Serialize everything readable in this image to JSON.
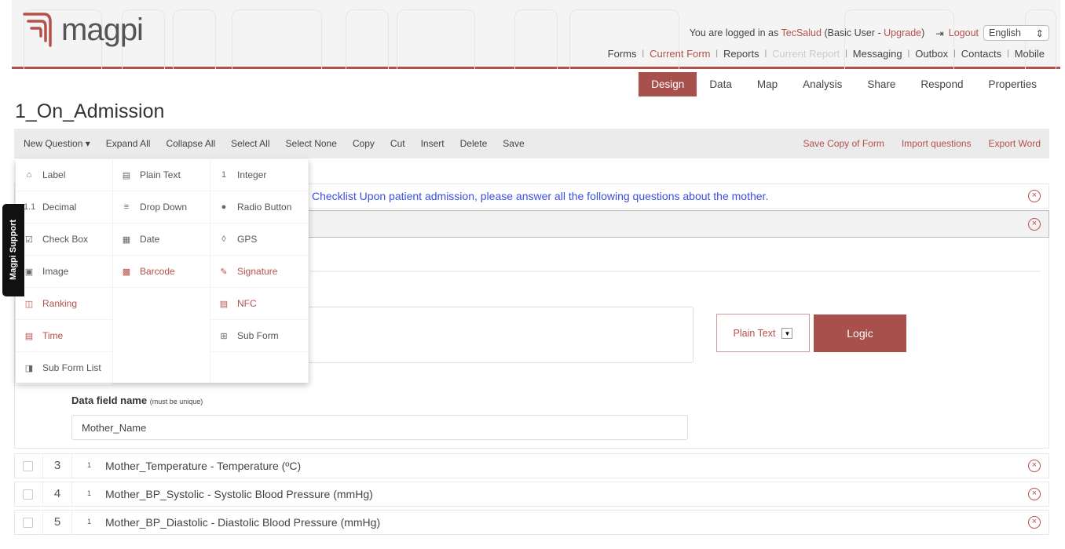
{
  "header": {
    "logo_text": "magpi",
    "user": {
      "prefix": "You are logged in as",
      "username": "TecSalud",
      "plan_open": "(Basic User -",
      "upgrade": "Upgrade",
      "plan_close": ")",
      "logout": "Logout",
      "language": "English"
    },
    "nav": [
      {
        "label": "Forms",
        "state": "normal"
      },
      {
        "label": "Current Form",
        "state": "active"
      },
      {
        "label": "Reports",
        "state": "normal"
      },
      {
        "label": "Current Report",
        "state": "disabled"
      },
      {
        "label": "Messaging",
        "state": "normal"
      },
      {
        "label": "Outbox",
        "state": "normal"
      },
      {
        "label": "Contacts",
        "state": "normal"
      },
      {
        "label": "Mobile",
        "state": "normal"
      }
    ]
  },
  "tabs": [
    {
      "label": "Design",
      "active": true
    },
    {
      "label": "Data"
    },
    {
      "label": "Map"
    },
    {
      "label": "Analysis"
    },
    {
      "label": "Share"
    },
    {
      "label": "Respond"
    },
    {
      "label": "Properties"
    }
  ],
  "form_title": "1_On_Admission",
  "toolbar": {
    "left": [
      "New Question ▾",
      "Expand All",
      "Collapse All",
      "Select All",
      "Select None",
      "Copy",
      "Cut",
      "Insert",
      "Delete",
      "Save"
    ],
    "right": [
      "Save Copy of Form",
      "Import questions",
      "Export Word"
    ]
  },
  "new_question_menu": {
    "columns": [
      [
        {
          "label": "Label",
          "icon": "tag-icon",
          "glyph": "⌂",
          "pro": false
        },
        {
          "label": "Decimal",
          "icon": "decimal-icon",
          "glyph": "1.1",
          "pro": false
        },
        {
          "label": "Check Box",
          "icon": "checkbox-icon",
          "glyph": "☑",
          "pro": false
        },
        {
          "label": "Image",
          "icon": "image-icon",
          "glyph": "▣",
          "pro": false
        },
        {
          "label": "Ranking",
          "icon": "ranking-icon",
          "glyph": "◫",
          "pro": true
        },
        {
          "label": "Time",
          "icon": "time-icon",
          "glyph": "▤",
          "pro": true
        },
        {
          "label": "Sub Form List",
          "icon": "subform-list-icon",
          "glyph": "◨",
          "pro": false
        }
      ],
      [
        {
          "label": "Plain Text",
          "icon": "plain-text-icon",
          "glyph": "▤",
          "pro": false
        },
        {
          "label": "Drop Down",
          "icon": "dropdown-icon",
          "glyph": "≡",
          "pro": false
        },
        {
          "label": "Date",
          "icon": "calendar-icon",
          "glyph": "▦",
          "pro": false
        },
        {
          "label": "Barcode",
          "icon": "qr-code-icon",
          "glyph": "▩",
          "pro": true
        }
      ],
      [
        {
          "label": "Integer",
          "icon": "integer-icon",
          "glyph": "1",
          "pro": false
        },
        {
          "label": "Radio Button",
          "icon": "radio-icon",
          "glyph": "●",
          "pro": false
        },
        {
          "label": "GPS",
          "icon": "location-pin-icon",
          "glyph": "◊",
          "pro": false
        },
        {
          "label": "Signature",
          "icon": "signature-icon",
          "glyph": "✎",
          "pro": true
        },
        {
          "label": "NFC",
          "icon": "nfc-icon",
          "glyph": "▤",
          "pro": true
        },
        {
          "label": "Sub Form",
          "icon": "subform-icon",
          "glyph": "⊞",
          "pro": false
        }
      ]
    ]
  },
  "support_tab": "Magpi Support",
  "questions": {
    "label_row_text": "Checklist Upon patient admission, please answer all the following questions about the mother.",
    "editor": {
      "type_select": "Plain Text",
      "logic_button": "Logic",
      "data_field_label": "Data field name",
      "data_field_hint": "(must be unique)",
      "data_field_value": "Mother_Name"
    },
    "rows": [
      {
        "number": "3",
        "type_icon": "1",
        "text": "Mother_Temperature - Temperature (ºC)"
      },
      {
        "number": "4",
        "type_icon": "1",
        "text": "Mother_BP_Systolic - Systolic Blood Pressure (mmHg)"
      },
      {
        "number": "5",
        "type_icon": "1",
        "text": "Mother_BP_Diastolic - Diastolic Blood Pressure (mmHg)"
      }
    ]
  },
  "colors": {
    "brand": "#b5504b",
    "active_tab": "#a8504b",
    "label_text": "#3b4fe0"
  }
}
